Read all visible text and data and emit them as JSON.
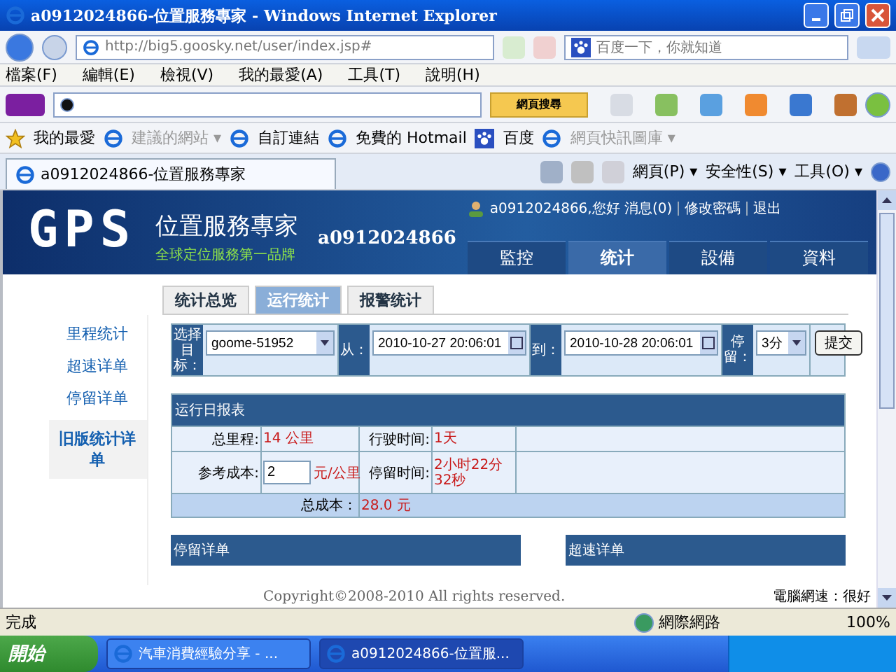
{
  "window": {
    "title": "a0912024866-位置服務專家 - Windows Internet Explorer"
  },
  "address_bar": {
    "url": "http://big5.goosky.net/user/index.jsp#",
    "search_placeholder": "百度一下，你就知道"
  },
  "menu": [
    "檔案(F)",
    "編輯(E)",
    "檢視(V)",
    "我的最愛(A)",
    "工具(T)",
    "說明(H)"
  ],
  "yahoo_toolbar": {
    "search_button": "網頁搜尋"
  },
  "favorites_bar": [
    {
      "label": "我的最愛",
      "kind": "star"
    },
    {
      "label": "建議的網站 ▾",
      "kind": "link",
      "disabled": true
    },
    {
      "label": "自訂連結",
      "kind": "link",
      "disabled": false
    },
    {
      "label": "免費的 Hotmail",
      "kind": "link",
      "disabled": false
    },
    {
      "label": "百度",
      "kind": "paw",
      "disabled": false
    },
    {
      "label": "網頁快訊圖庫 ▾",
      "kind": "link",
      "disabled": true
    }
  ],
  "browser_tabs": [
    {
      "label": "a0912024866-位置服務專家",
      "selected": true
    }
  ],
  "command_bar": [
    "網頁(P) ▾",
    "安全性(S) ▾",
    "工具(O) ▾"
  ],
  "site_header": {
    "logo": "GPS",
    "title": "位置服務專家",
    "slogan": "全球定位服務第一品牌",
    "account": "a0912024866",
    "user_links": [
      "a0912024866,您好 消息(0)",
      "修改密碼",
      "退出"
    ],
    "nav": [
      {
        "label": "監控",
        "selected": false
      },
      {
        "label": "统计",
        "selected": true
      },
      {
        "label": "設備",
        "selected": false
      },
      {
        "label": "資料",
        "selected": false
      }
    ]
  },
  "sub_tabs": [
    {
      "label": "统计总览",
      "selected": false
    },
    {
      "label": "运行统计",
      "selected": true
    },
    {
      "label": "报警统计",
      "selected": false
    }
  ],
  "sidebar": [
    {
      "label": "里程统计",
      "selected": false
    },
    {
      "label": "超速详单",
      "selected": false
    },
    {
      "label": "停留详单",
      "selected": false
    },
    {
      "label": "旧版统计详单",
      "selected": true
    }
  ],
  "query": {
    "target_label": "选择目标：",
    "target": "goome-51952",
    "from_label": "从：",
    "from": "2010-10-27 20:06:01",
    "to_label": "到：",
    "to": "2010-10-28 20:06:01",
    "stop_label": "停留：",
    "stop": "3分",
    "submit": "提交"
  },
  "report": {
    "title": "运行日报表",
    "rows": [
      [
        {
          "label": "总里程:",
          "value": "14 公里"
        },
        {
          "label": "行驶时间:",
          "value": "1天"
        }
      ],
      [
        {
          "label": "参考成本:",
          "input": "2",
          "unit": "元/公里"
        },
        {
          "label": "停留时间:",
          "value": "2小时22分32秒"
        }
      ]
    ],
    "total_label": "总成本：",
    "total": "28.0 元"
  },
  "panels": [
    "停留详单",
    "超速详单"
  ],
  "footer": {
    "copyright": "Copyright©2008-2010 All rights reserved.",
    "speed": "電腦網速：很好"
  },
  "status_bar": {
    "text": "完成",
    "zone": "網際網路",
    "zoom": "100%"
  },
  "taskbar": {
    "start": "開始",
    "tasks": [
      {
        "label": "汽車消費經驗分享 - ...",
        "selected": false
      },
      {
        "label": "a0912024866-位置服...",
        "selected": true
      }
    ]
  }
}
